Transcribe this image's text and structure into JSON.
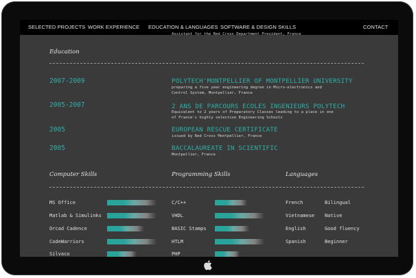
{
  "nav": {
    "selected_projects": "SELECTED PROJECTS",
    "work_experience": "WORK EXPERIENCE",
    "education_languages": "EDUCATION & LANGUAGES",
    "software_design_skills": "SOFTWARE  & DESIGN SKILLS",
    "contact": "CONTACT"
  },
  "previous_line": "Assistant for the Red Cross Department President, France",
  "education": {
    "heading": "Education",
    "entries": [
      {
        "years": "2007-2009",
        "title": "POLYTECH'MONTPELLIER OF MONTPELLIER UNIVERSITY",
        "desc": "preparing a five year engineering degree in Micro-electronics and Control System, Montpellier, France"
      },
      {
        "years": "2005-2007",
        "title": "2 ANS DE PARCOURS ECOLES INGENIEURS POLYTECH",
        "desc": "Equivalent to 2 years of Preparatory Classes leading to a place in one of France's highly selective Engineering Schools"
      },
      {
        "years": "2005",
        "title": "EUROPEAN RESCUE CERTIFICATE",
        "desc": "issued by Red Cross Montpellier, France"
      },
      {
        "years": "2005",
        "title": "BACCALAUREATE IN SCIENTIFIC",
        "desc": "Montpellier, France"
      }
    ]
  },
  "computer_skills": {
    "heading": "Computer Skills",
    "items": [
      {
        "name": "MS Office",
        "level": 1.0
      },
      {
        "name": "Matlab & Simulinks",
        "level": 1.0
      },
      {
        "name": "Orcad Cadence",
        "level": 0.75
      },
      {
        "name": "CodeWarriors",
        "level": 1.0
      },
      {
        "name": "Silvaco",
        "level": 0.6
      }
    ]
  },
  "programming_skills": {
    "heading": "Programming Skills",
    "items": [
      {
        "name": "C/C++",
        "level": 0.65
      },
      {
        "name": "VHDL",
        "level": 1.0
      },
      {
        "name": "BASIC Stamps",
        "level": 0.7
      },
      {
        "name": "HTLM",
        "level": 1.0
      },
      {
        "name": "PHP",
        "level": 0.5
      }
    ]
  },
  "languages": {
    "heading": "Languages",
    "items": [
      {
        "name": "French",
        "level": "Bilingual"
      },
      {
        "name": "Vietnamese",
        "level": "Native"
      },
      {
        "name": "English",
        "level": "Good fluency"
      },
      {
        "name": "Spanish",
        "level": "Beginner"
      }
    ]
  },
  "colors": {
    "accent": "#2fb0a8",
    "screen_bg": "#3a3a3a",
    "nav_bg": "#000000",
    "bezel": "#0b0b0b"
  },
  "icons": {
    "home_button": "apple-logo-icon"
  }
}
